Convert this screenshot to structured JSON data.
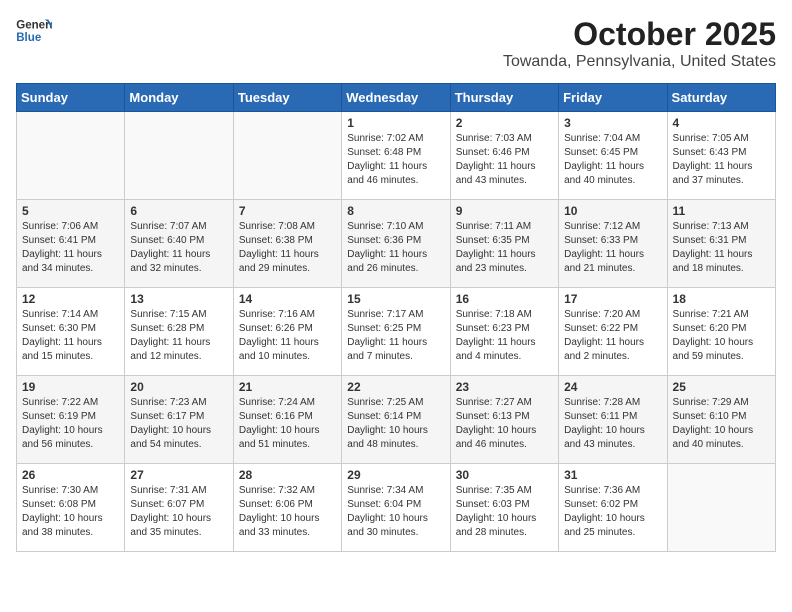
{
  "header": {
    "logo_line1": "General",
    "logo_line2": "Blue",
    "title": "October 2025",
    "subtitle": "Towanda, Pennsylvania, United States"
  },
  "days_of_week": [
    "Sunday",
    "Monday",
    "Tuesday",
    "Wednesday",
    "Thursday",
    "Friday",
    "Saturday"
  ],
  "weeks": [
    [
      {
        "day": "",
        "sunrise": "",
        "sunset": "",
        "daylight": ""
      },
      {
        "day": "",
        "sunrise": "",
        "sunset": "",
        "daylight": ""
      },
      {
        "day": "",
        "sunrise": "",
        "sunset": "",
        "daylight": ""
      },
      {
        "day": "1",
        "sunrise": "Sunrise: 7:02 AM",
        "sunset": "Sunset: 6:48 PM",
        "daylight": "Daylight: 11 hours and 46 minutes."
      },
      {
        "day": "2",
        "sunrise": "Sunrise: 7:03 AM",
        "sunset": "Sunset: 6:46 PM",
        "daylight": "Daylight: 11 hours and 43 minutes."
      },
      {
        "day": "3",
        "sunrise": "Sunrise: 7:04 AM",
        "sunset": "Sunset: 6:45 PM",
        "daylight": "Daylight: 11 hours and 40 minutes."
      },
      {
        "day": "4",
        "sunrise": "Sunrise: 7:05 AM",
        "sunset": "Sunset: 6:43 PM",
        "daylight": "Daylight: 11 hours and 37 minutes."
      }
    ],
    [
      {
        "day": "5",
        "sunrise": "Sunrise: 7:06 AM",
        "sunset": "Sunset: 6:41 PM",
        "daylight": "Daylight: 11 hours and 34 minutes."
      },
      {
        "day": "6",
        "sunrise": "Sunrise: 7:07 AM",
        "sunset": "Sunset: 6:40 PM",
        "daylight": "Daylight: 11 hours and 32 minutes."
      },
      {
        "day": "7",
        "sunrise": "Sunrise: 7:08 AM",
        "sunset": "Sunset: 6:38 PM",
        "daylight": "Daylight: 11 hours and 29 minutes."
      },
      {
        "day": "8",
        "sunrise": "Sunrise: 7:10 AM",
        "sunset": "Sunset: 6:36 PM",
        "daylight": "Daylight: 11 hours and 26 minutes."
      },
      {
        "day": "9",
        "sunrise": "Sunrise: 7:11 AM",
        "sunset": "Sunset: 6:35 PM",
        "daylight": "Daylight: 11 hours and 23 minutes."
      },
      {
        "day": "10",
        "sunrise": "Sunrise: 7:12 AM",
        "sunset": "Sunset: 6:33 PM",
        "daylight": "Daylight: 11 hours and 21 minutes."
      },
      {
        "day": "11",
        "sunrise": "Sunrise: 7:13 AM",
        "sunset": "Sunset: 6:31 PM",
        "daylight": "Daylight: 11 hours and 18 minutes."
      }
    ],
    [
      {
        "day": "12",
        "sunrise": "Sunrise: 7:14 AM",
        "sunset": "Sunset: 6:30 PM",
        "daylight": "Daylight: 11 hours and 15 minutes."
      },
      {
        "day": "13",
        "sunrise": "Sunrise: 7:15 AM",
        "sunset": "Sunset: 6:28 PM",
        "daylight": "Daylight: 11 hours and 12 minutes."
      },
      {
        "day": "14",
        "sunrise": "Sunrise: 7:16 AM",
        "sunset": "Sunset: 6:26 PM",
        "daylight": "Daylight: 11 hours and 10 minutes."
      },
      {
        "day": "15",
        "sunrise": "Sunrise: 7:17 AM",
        "sunset": "Sunset: 6:25 PM",
        "daylight": "Daylight: 11 hours and 7 minutes."
      },
      {
        "day": "16",
        "sunrise": "Sunrise: 7:18 AM",
        "sunset": "Sunset: 6:23 PM",
        "daylight": "Daylight: 11 hours and 4 minutes."
      },
      {
        "day": "17",
        "sunrise": "Sunrise: 7:20 AM",
        "sunset": "Sunset: 6:22 PM",
        "daylight": "Daylight: 11 hours and 2 minutes."
      },
      {
        "day": "18",
        "sunrise": "Sunrise: 7:21 AM",
        "sunset": "Sunset: 6:20 PM",
        "daylight": "Daylight: 10 hours and 59 minutes."
      }
    ],
    [
      {
        "day": "19",
        "sunrise": "Sunrise: 7:22 AM",
        "sunset": "Sunset: 6:19 PM",
        "daylight": "Daylight: 10 hours and 56 minutes."
      },
      {
        "day": "20",
        "sunrise": "Sunrise: 7:23 AM",
        "sunset": "Sunset: 6:17 PM",
        "daylight": "Daylight: 10 hours and 54 minutes."
      },
      {
        "day": "21",
        "sunrise": "Sunrise: 7:24 AM",
        "sunset": "Sunset: 6:16 PM",
        "daylight": "Daylight: 10 hours and 51 minutes."
      },
      {
        "day": "22",
        "sunrise": "Sunrise: 7:25 AM",
        "sunset": "Sunset: 6:14 PM",
        "daylight": "Daylight: 10 hours and 48 minutes."
      },
      {
        "day": "23",
        "sunrise": "Sunrise: 7:27 AM",
        "sunset": "Sunset: 6:13 PM",
        "daylight": "Daylight: 10 hours and 46 minutes."
      },
      {
        "day": "24",
        "sunrise": "Sunrise: 7:28 AM",
        "sunset": "Sunset: 6:11 PM",
        "daylight": "Daylight: 10 hours and 43 minutes."
      },
      {
        "day": "25",
        "sunrise": "Sunrise: 7:29 AM",
        "sunset": "Sunset: 6:10 PM",
        "daylight": "Daylight: 10 hours and 40 minutes."
      }
    ],
    [
      {
        "day": "26",
        "sunrise": "Sunrise: 7:30 AM",
        "sunset": "Sunset: 6:08 PM",
        "daylight": "Daylight: 10 hours and 38 minutes."
      },
      {
        "day": "27",
        "sunrise": "Sunrise: 7:31 AM",
        "sunset": "Sunset: 6:07 PM",
        "daylight": "Daylight: 10 hours and 35 minutes."
      },
      {
        "day": "28",
        "sunrise": "Sunrise: 7:32 AM",
        "sunset": "Sunset: 6:06 PM",
        "daylight": "Daylight: 10 hours and 33 minutes."
      },
      {
        "day": "29",
        "sunrise": "Sunrise: 7:34 AM",
        "sunset": "Sunset: 6:04 PM",
        "daylight": "Daylight: 10 hours and 30 minutes."
      },
      {
        "day": "30",
        "sunrise": "Sunrise: 7:35 AM",
        "sunset": "Sunset: 6:03 PM",
        "daylight": "Daylight: 10 hours and 28 minutes."
      },
      {
        "day": "31",
        "sunrise": "Sunrise: 7:36 AM",
        "sunset": "Sunset: 6:02 PM",
        "daylight": "Daylight: 10 hours and 25 minutes."
      },
      {
        "day": "",
        "sunrise": "",
        "sunset": "",
        "daylight": ""
      }
    ]
  ]
}
